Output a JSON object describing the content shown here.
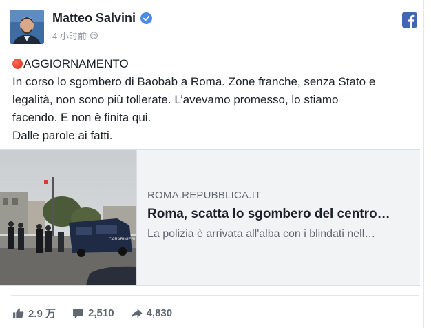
{
  "post": {
    "author": "Matteo Salvini",
    "timestamp": "4 小时前",
    "text_lines": [
      "AGGIORNAMENTO",
      "In corso lo sgombero di Baobab a Roma. Zone franche, senza Stato e",
      "legalità, non sono più tollerate. L’avevamo promesso, lo stiamo",
      "facendo. E non è finita qui.",
      "Dalle parole ai fatti."
    ]
  },
  "link": {
    "domain": "ROMA.REPUBBLICA.IT",
    "title": "Roma, scatta lo sgombero del centro…",
    "description": "La polizia è arrivata all'alba con i blindati nell…",
    "thumbnail_caption": "CARABINIERI"
  },
  "stats": {
    "likes": "2.9 万",
    "comments": "2,510",
    "shares": "4,830"
  },
  "icons": {
    "verified": "verified-badge-icon",
    "globe": "globe-icon",
    "facebook": "facebook-logo-icon",
    "red_circle": "red-circle-emoji",
    "like": "thumbs-up-icon",
    "comment": "comment-bubble-icon",
    "share": "share-arrow-icon"
  },
  "colors": {
    "accent": "#4267b2",
    "verified": "#4a8ce8",
    "text": "#1d2129",
    "muted": "#606770"
  }
}
